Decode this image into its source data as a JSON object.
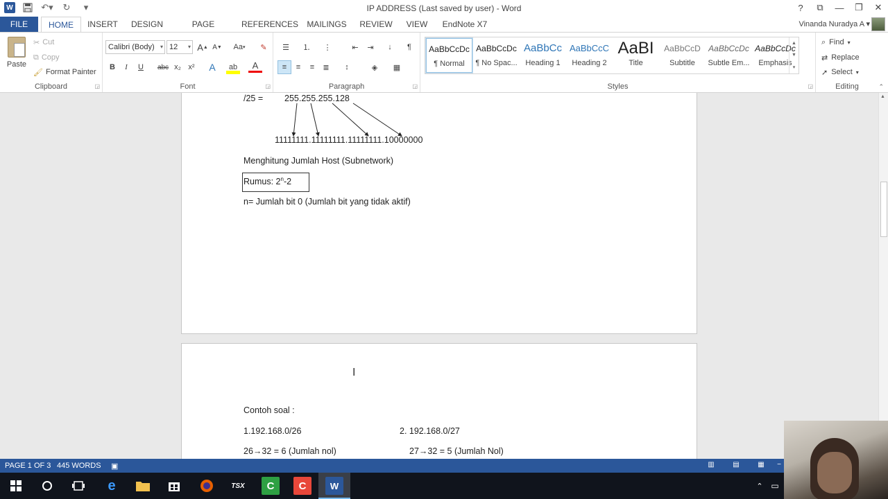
{
  "window": {
    "title": "IP ADDRESS (Last saved by user) - Word",
    "controls": [
      "?",
      "⧉",
      "—",
      "❐",
      "✕"
    ]
  },
  "quick_access": {
    "icons": [
      "word-logo-icon",
      "save-icon",
      "undo-icon",
      "redo-icon",
      "customize-icon"
    ]
  },
  "tabs": [
    {
      "label": "FILE"
    },
    {
      "label": "HOME"
    },
    {
      "label": "INSERT"
    },
    {
      "label": "DESIGN"
    },
    {
      "label": "PAGE LAYOUT"
    },
    {
      "label": "REFERENCES"
    },
    {
      "label": "MAILINGS"
    },
    {
      "label": "REVIEW"
    },
    {
      "label": "VIEW"
    },
    {
      "label": "EndNote X7"
    }
  ],
  "active_tab": "HOME",
  "user": {
    "name": "Vinanda Nuradya A"
  },
  "clipboard": {
    "paste": "Paste",
    "cut": "Cut",
    "copy": "Copy",
    "format_painter": "Format Painter",
    "group_label": "Clipboard"
  },
  "font": {
    "family": "Calibri (Body)",
    "size": "12",
    "group_label": "Font",
    "buttons": {
      "grow": "A",
      "shrink": "A",
      "case": "Aa",
      "bold": "B",
      "italic": "I",
      "underline": "U",
      "strike": "abc",
      "subscript": "x₂",
      "superscript": "x²",
      "effects": "A",
      "highlight": "ab",
      "color": "A"
    }
  },
  "paragraph": {
    "group_label": "Paragraph"
  },
  "styles": {
    "group_label": "Styles",
    "items": [
      {
        "sample": "AaBbCcDc",
        "name": "¶ Normal",
        "selected": true
      },
      {
        "sample": "AaBbCcDc",
        "name": "¶ No Spac..."
      },
      {
        "sample": "AaBbCc",
        "name": "Heading 1"
      },
      {
        "sample": "AaBbCcC",
        "name": "Heading 2"
      },
      {
        "sample": "AaBI",
        "name": "Title"
      },
      {
        "sample": "AaBbCcD",
        "name": "Subtitle"
      },
      {
        "sample": "AaBbCcDc",
        "name": "Subtle Em..."
      },
      {
        "sample": "AaBbCcDc",
        "name": "Emphasis"
      }
    ]
  },
  "editing": {
    "group_label": "Editing",
    "find": "Find",
    "replace": "Replace",
    "select": "Select"
  },
  "document": {
    "page1": {
      "mask_line_prefix": "/25 =",
      "mask_line_value": "255.255.255.128",
      "binary_line": "11111111.11111111.11111111.10000000",
      "heading": "Menghitung Jumlah Host (Subnetwork)",
      "formula_prefix": "Rumus: 2",
      "formula_sup": "n",
      "formula_suffix": "-2",
      "note": "n= Jumlah bit 0 (Jumlah bit yang tidak aktif)"
    },
    "page2": {
      "example_heading": "Contoh soal :",
      "example1": "1.192.168.0/26",
      "example2": "2. 192.168.0/27",
      "calc1": "26→32 = 6 (Jumlah nol)",
      "calc2": "27→32 = 5 (Jumlah Nol)"
    }
  },
  "status": {
    "page": "PAGE 1 OF 3",
    "words": "445 WORDS"
  },
  "colors": {
    "accent": "#2b579a",
    "taskbar": "#10141c"
  }
}
